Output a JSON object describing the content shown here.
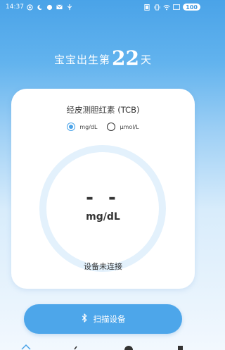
{
  "status_bar": {
    "time": "14:37",
    "battery": "100"
  },
  "heading": {
    "prefix": "宝宝出生第",
    "day": "22",
    "suffix": "天"
  },
  "card": {
    "title": "经皮测胆红素 (TCB)",
    "units": [
      {
        "label": "mg/dL",
        "selected": true
      },
      {
        "label": "μmol/L",
        "selected": false
      }
    ],
    "reading": "- -",
    "reading_unit": "mg/dL",
    "connection_status": "设备未连接"
  },
  "scan_button": {
    "label": "扫描设备",
    "icon": "bluetooth-icon"
  },
  "colors": {
    "accent": "#4aa3e8",
    "gauge_ring": "#e3f1fc"
  }
}
